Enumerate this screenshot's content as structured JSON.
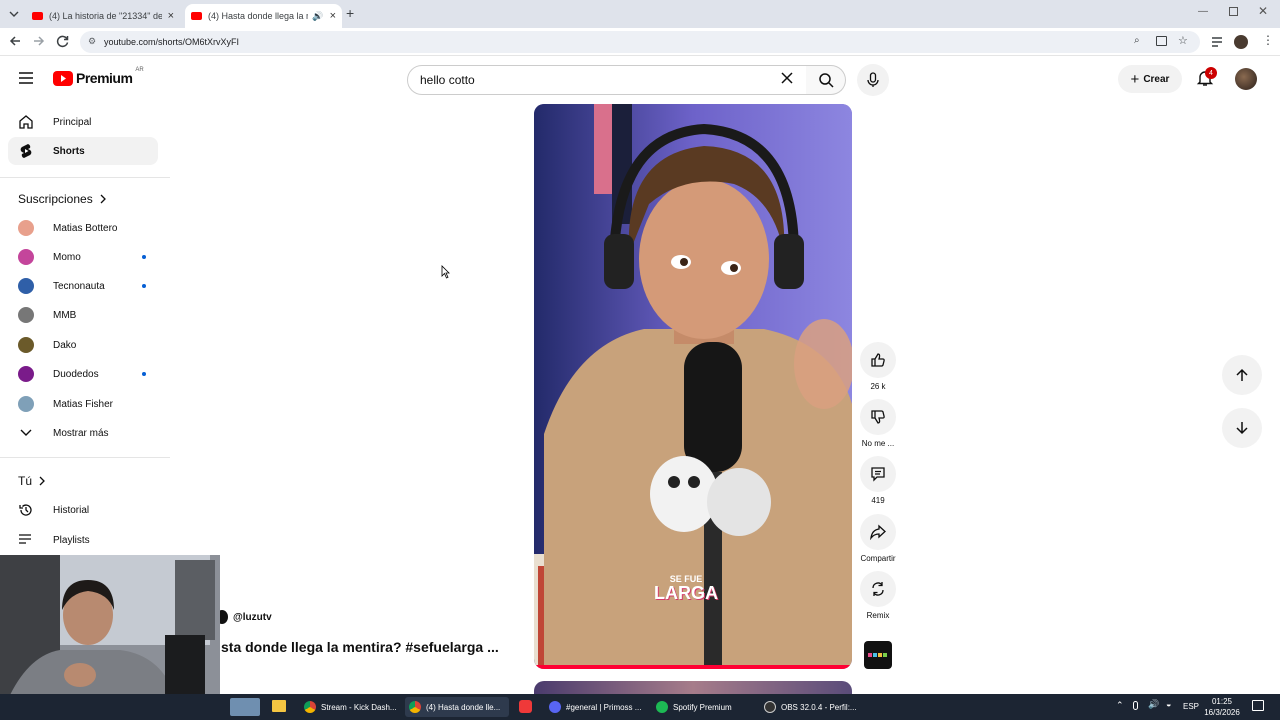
{
  "browser": {
    "tabs": [
      {
        "title": "(4) La historia de \"21334\" de D",
        "active": false
      },
      {
        "title": "(4) Hasta donde llega la me",
        "active": true
      }
    ],
    "url": "youtube.com/shorts/OM6tXrvXyFI"
  },
  "header": {
    "logo": "Premium",
    "region": "AR",
    "search_value": "hello cotto",
    "create_label": "Crear",
    "notifications_count": "4"
  },
  "sidebar": {
    "main": [
      {
        "label": "Principal",
        "icon": "home-icon"
      },
      {
        "label": "Shorts",
        "icon": "shorts-icon",
        "active": true
      }
    ],
    "subscriptions_title": "Suscripciones",
    "subscriptions": [
      {
        "label": "Matias Bottero",
        "color": "#e8a08c",
        "new": false
      },
      {
        "label": "Momo",
        "color": "#c4459b",
        "new": true
      },
      {
        "label": "Tecnonauta",
        "color": "#2f5fa8",
        "new": true
      },
      {
        "label": "MMB",
        "color": "#777777",
        "new": false
      },
      {
        "label": "Dako",
        "color": "#6b5a2a",
        "new": false
      },
      {
        "label": "Duodedos",
        "color": "#7a1b8a",
        "new": true
      },
      {
        "label": "Matias Fisher",
        "color": "#7fa0b8",
        "new": false
      }
    ],
    "show_more": "Mostrar más",
    "you_title": "Tú",
    "you": [
      {
        "label": "Historial",
        "icon": "history-icon"
      },
      {
        "label": "Playlists",
        "icon": "playlists-icon"
      }
    ]
  },
  "short": {
    "channel": "@luzutv",
    "title": "sta donde llega la mentira? #sefuelarga ...",
    "overlay_line1": "SE FUE",
    "overlay_line2": "LARGA",
    "likes": "26 k",
    "dislike_label": "No me ...",
    "comments": "419",
    "share_label": "Compartir",
    "remix_label": "Remix"
  },
  "taskbar": {
    "items": [
      {
        "label": "Stream - Kick Dash...",
        "color": "#4caf50"
      },
      {
        "label": "(4) Hasta donde lle...",
        "color": "#fbbc04"
      },
      {
        "label": "#general | Primoss ...",
        "color": "#5865f2"
      },
      {
        "label": "Spotify Premium",
        "color": "#1db954"
      },
      {
        "label": "OBS 32.0.4 - Perfil:...",
        "color": "#333333"
      }
    ],
    "lang": "ESP",
    "time": "01:25",
    "date": "16/3/2026"
  },
  "colors": {
    "brand": "#ff0000",
    "link": "#065fd4"
  }
}
